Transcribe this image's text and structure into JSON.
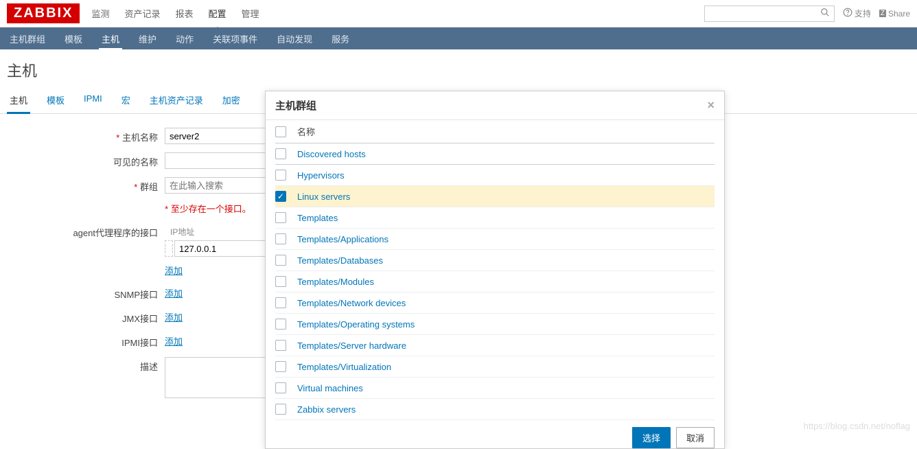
{
  "logo": "ZABBIX",
  "top_nav": {
    "items": [
      "监测",
      "资产记录",
      "报表",
      "配置",
      "管理"
    ],
    "active_index": 3
  },
  "top_right": {
    "support": "支持",
    "share": "Share",
    "share_badge": "Z"
  },
  "sub_nav": {
    "items": [
      "主机群组",
      "模板",
      "主机",
      "维护",
      "动作",
      "关联项事件",
      "自动发现",
      "服务"
    ],
    "active_index": 2
  },
  "page_title": "主机",
  "form_tabs": {
    "items": [
      "主机",
      "模板",
      "IPMI",
      "宏",
      "主机资产记录",
      "加密"
    ],
    "active_index": 0
  },
  "form": {
    "host_name_label": "主机名称",
    "host_name_value": "server2",
    "visible_name_label": "可见的名称",
    "visible_name_value": "",
    "groups_label": "群组",
    "groups_placeholder": "在此输入搜索",
    "interface_hint": "至少存在一个接口。",
    "agent_label": "agent代理程序的接口",
    "ip_header": "IP地址",
    "ip_value": "127.0.0.1",
    "add_label": "添加",
    "snmp_label": "SNMP接口",
    "jmx_label": "JMX接口",
    "ipmi_label": "IPMI接口",
    "desc_label": "描述"
  },
  "modal": {
    "title": "主机群组",
    "header_label": "名称",
    "groups": [
      {
        "name": "Discovered hosts",
        "checked": false
      },
      {
        "name": "Hypervisors",
        "checked": false
      },
      {
        "name": "Linux servers",
        "checked": true
      },
      {
        "name": "Templates",
        "checked": false
      },
      {
        "name": "Templates/Applications",
        "checked": false
      },
      {
        "name": "Templates/Databases",
        "checked": false
      },
      {
        "name": "Templates/Modules",
        "checked": false
      },
      {
        "name": "Templates/Network devices",
        "checked": false
      },
      {
        "name": "Templates/Operating systems",
        "checked": false
      },
      {
        "name": "Templates/Server hardware",
        "checked": false
      },
      {
        "name": "Templates/Virtualization",
        "checked": false
      },
      {
        "name": "Virtual machines",
        "checked": false
      },
      {
        "name": "Zabbix servers",
        "checked": false
      }
    ],
    "select_btn": "选择",
    "cancel_btn": "取消"
  },
  "watermark": "https://blog.csdn.net/noflag"
}
